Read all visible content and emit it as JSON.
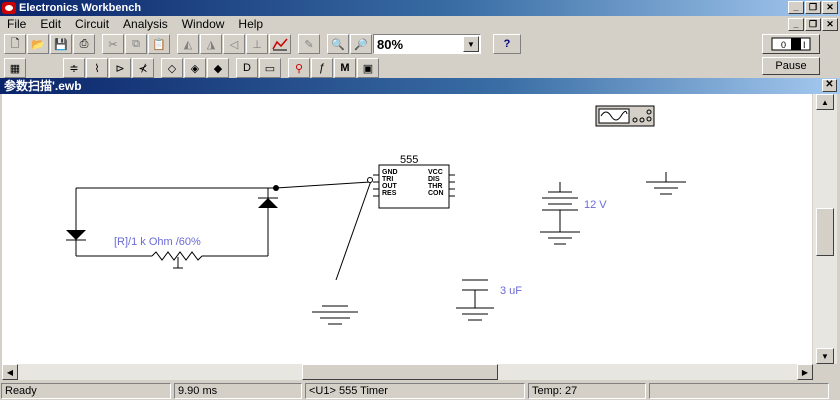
{
  "app": {
    "title": "Electronics Workbench"
  },
  "menu": [
    "File",
    "Edit",
    "Circuit",
    "Analysis",
    "Window",
    "Help"
  ],
  "zoom": {
    "value": "80%"
  },
  "help_button": "?",
  "pause_button": "Pause",
  "document": {
    "title": "参数扫描'.ewb"
  },
  "components": {
    "resistor_label": "[R]/1 k Ohm /60%",
    "battery_label": "12 V",
    "capacitor_label": "3 uF",
    "timer_title": "555",
    "timer_pins_left": [
      "GND",
      "TRI",
      "OUT",
      "RES"
    ],
    "timer_pins_right": [
      "VCC",
      "DIS",
      "THR",
      "CON"
    ]
  },
  "status": {
    "state": "Ready",
    "time": "9.90 ms",
    "selection": "<U1> 555 Timer",
    "temp": "Temp:  27"
  },
  "colors": {
    "label": "#6a6ad8",
    "title_bar": "#0a246a"
  }
}
